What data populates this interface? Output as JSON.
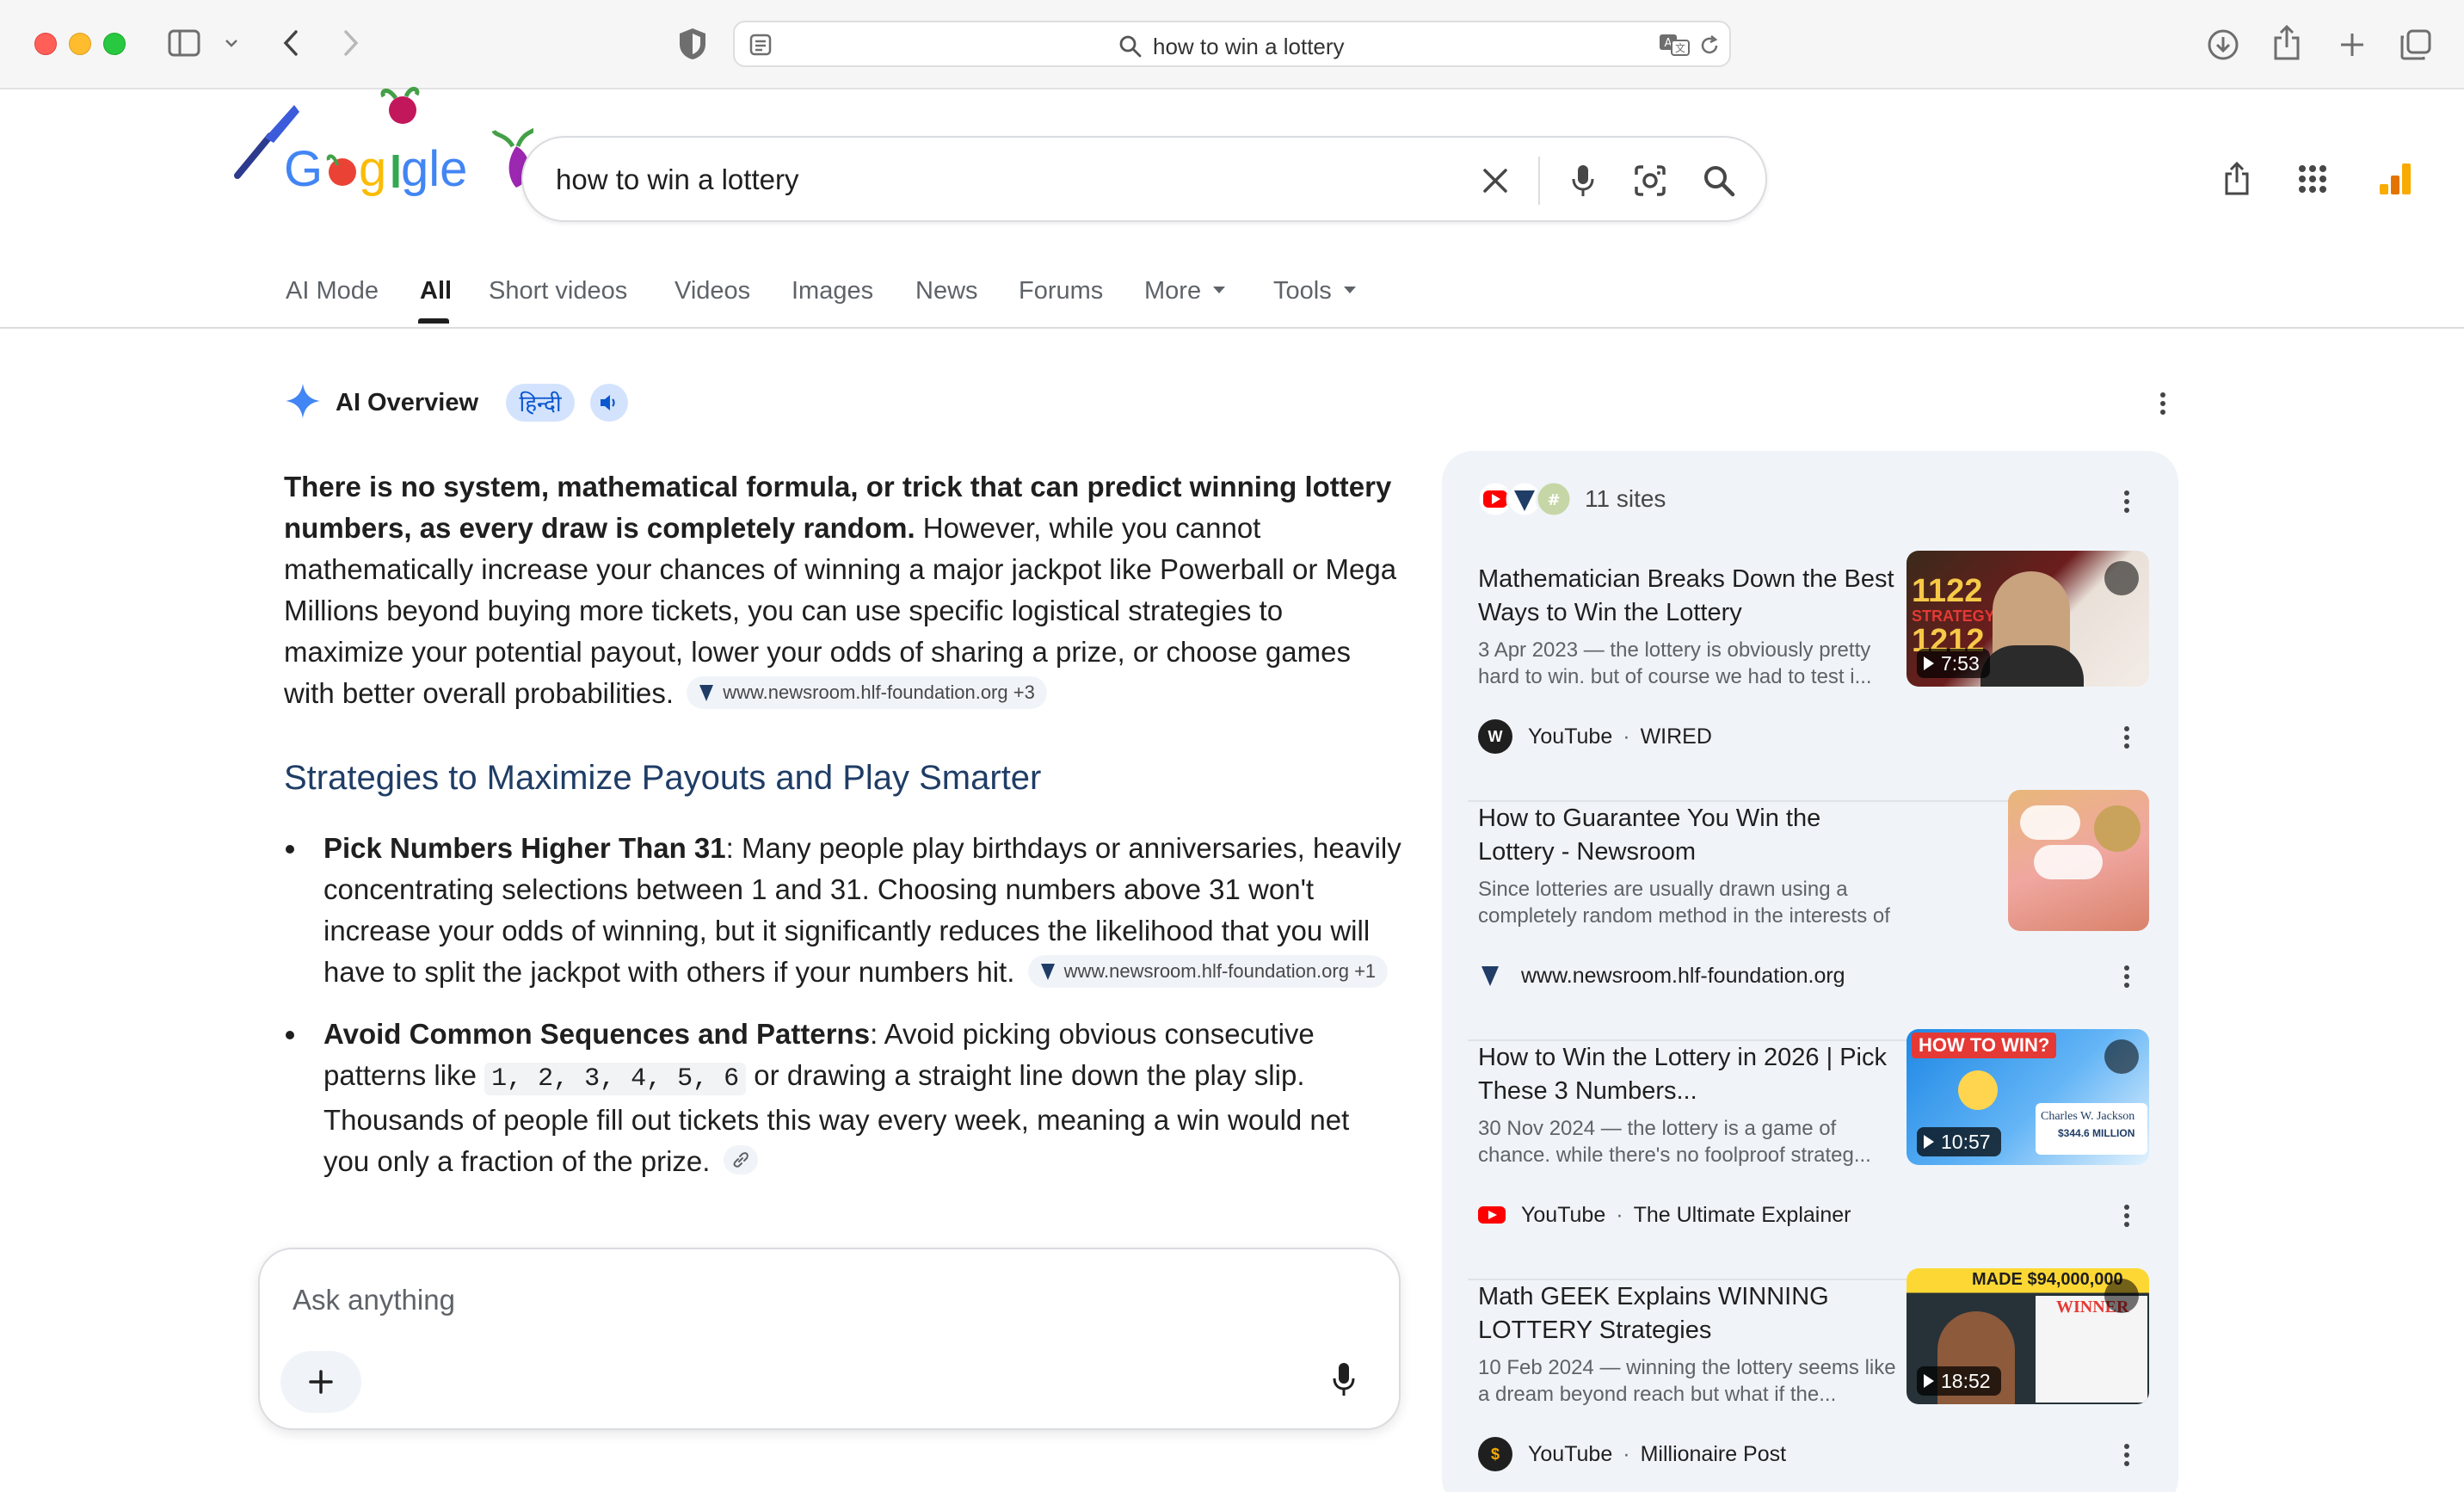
{
  "browser": {
    "url_text": "how to win a lottery"
  },
  "search": {
    "query": "how to win a lottery"
  },
  "tabs": [
    {
      "label": "AI Mode"
    },
    {
      "label": "All"
    },
    {
      "label": "Short videos"
    },
    {
      "label": "Videos"
    },
    {
      "label": "Images"
    },
    {
      "label": "News"
    },
    {
      "label": "Forums"
    },
    {
      "label": "More"
    },
    {
      "label": "Tools"
    }
  ],
  "aio": {
    "title": "AI Overview",
    "lang_pill": "हिन्दी",
    "intro_bold": "There is no system, mathematical formula, or trick that can predict winning lottery numbers, as every draw is completely random.",
    "intro_rest": " However, while you cannot mathematically increase your chances of winning a major jackpot like Powerball or Mega Millions beyond buying more tickets, you can use specific logistical strategies to maximize your potential payout, lower your odds of sharing a prize, or choose games with better overall probabilities.",
    "intro_cite": "www.newsroom.hlf-foundation.org +3",
    "heading": "Strategies to Maximize Payouts and Play Smarter",
    "bullet1_bold": "Pick Numbers Higher Than 31",
    "bullet1_text": ": Many people play birthdays or anniversaries, heavily concentrating selections between 1 and 31. Choosing numbers above 31 won't increase your odds of winning, but it significantly reduces the likelihood that you will have to split the jackpot with others if your numbers hit.",
    "bullet1_cite": "www.newsroom.hlf-foundation.org +1",
    "bullet2_bold": "Avoid Common Sequences and Patterns",
    "bullet2_a": ": Avoid picking obvious consecutive patterns like ",
    "bullet2_code": "1, 2, 3, 4, 5, 6",
    "bullet2_b": " or drawing a straight line down the play slip. Thousands of people fill out tickets this way every week, meaning a win would net you only a fraction of the prize."
  },
  "ask": {
    "placeholder": "Ask anything"
  },
  "sources": {
    "count_label": "11 sites",
    "items": [
      {
        "title": "Mathematician Breaks Down the Best Ways to Win the Lottery",
        "snippet": "3 Apr 2023 — the lottery is obviously pretty hard to win. but of course we had to test i...",
        "site": "YouTube",
        "channel": "WIRED",
        "duration": "7:53",
        "thumb_text_1": "1122",
        "thumb_text_2": "STRATEGY",
        "thumb_text_3": "1212"
      },
      {
        "title": "How to Guarantee You Win the Lottery - Newsroom",
        "snippet": "Since lotteries are usually drawn using a completely random method in the interests of fairness, it is...",
        "site": "www.newsroom.hlf-foundation.org",
        "channel": "",
        "duration": ""
      },
      {
        "title": "How to Win the Lottery in 2026 | Pick These 3 Numbers...",
        "snippet": "30 Nov 2024 — the lottery is a game of chance. while there's no foolproof strateg...",
        "site": "YouTube",
        "channel": "The Ultimate Explainer",
        "duration": "10:57",
        "thumb_text_1": "HOW TO WIN?",
        "thumb_text_2": "Charles W. Jackson",
        "thumb_text_3": "$344.6 MILLION"
      },
      {
        "title": "Math GEEK Explains WINNING LOTTERY Strategies",
        "snippet": "10 Feb 2024 — winning the lottery seems like a dream beyond reach but what if the...",
        "site": "YouTube",
        "channel": "Millionaire Post",
        "duration": "18:52",
        "thumb_text_1": "MADE $94,000,000",
        "thumb_text_2": "WINNER"
      }
    ]
  },
  "colors": {
    "google_blue": "#4285f4",
    "link_pill_bg": "#d3e3fd",
    "youtube_red": "#ff0000",
    "panel_bg": "#f0f4f9"
  }
}
